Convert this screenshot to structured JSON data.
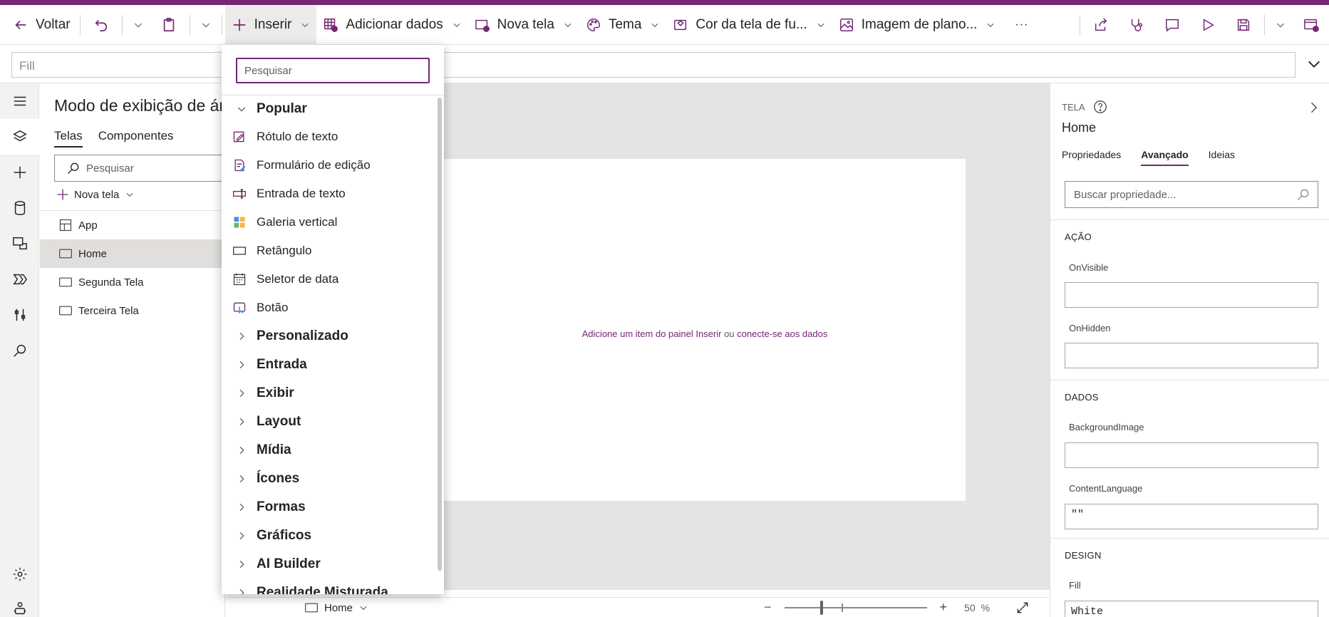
{
  "commandbar": {
    "back": "Voltar",
    "insert": "Inserir",
    "add_data": "Adicionar dados",
    "new_screen": "Nova tela",
    "theme": "Tema",
    "bg_color": "Cor da tela de fu...",
    "bg_image": "Imagem de plano...",
    "more": "···"
  },
  "formula": {
    "property": "Fill"
  },
  "tree": {
    "title": "Modo de exibição de árvore",
    "tabs": [
      "Telas",
      "Componentes"
    ],
    "search_placeholder": "Pesquisar",
    "new_screen": "Nova tela",
    "items": [
      {
        "label": "App",
        "icon": "app-icon"
      },
      {
        "label": "Home",
        "icon": "screen-icon",
        "selected": true
      },
      {
        "label": "Segunda Tela",
        "icon": "screen-icon"
      },
      {
        "label": "Terceira Tela",
        "icon": "screen-icon"
      }
    ]
  },
  "insert_panel": {
    "search_placeholder": "Pesquisar",
    "popular_label": "Popular",
    "popular_items": [
      {
        "label": "Rótulo de texto",
        "icon": "text-label-icon"
      },
      {
        "label": "Formulário de edição",
        "icon": "edit-form-icon"
      },
      {
        "label": "Entrada de texto",
        "icon": "text-input-icon"
      },
      {
        "label": "Galeria vertical",
        "icon": "gallery-icon"
      },
      {
        "label": "Retângulo",
        "icon": "rectangle-icon"
      },
      {
        "label": "Seletor de data",
        "icon": "date-picker-icon"
      },
      {
        "label": "Botão",
        "icon": "button-icon"
      }
    ],
    "categories": [
      "Personalizado",
      "Entrada",
      "Exibir",
      "Layout",
      "Mídia",
      "Ícones",
      "Formas",
      "Gráficos",
      "AI Builder",
      "Realidade Misturada"
    ]
  },
  "canvas": {
    "hint_link1": "Adicione um item do painel Inserir",
    "hint_or": " ou ",
    "hint_link2": "conecte-se aos dados"
  },
  "statusbar": {
    "screen": "Home",
    "zoom_value": "50",
    "zoom_unit": "%",
    "zoom_minus": "−",
    "zoom_plus": "+"
  },
  "props": {
    "kind": "TELA",
    "name": "Home",
    "tabs": [
      "Propriedades",
      "Avançado",
      "Ideias"
    ],
    "selected_tab": "Avançado",
    "search_placeholder": "Buscar propriedade...",
    "sections": {
      "action": "AÇÃO",
      "data": "DADOS",
      "design": "DESIGN"
    },
    "fields": {
      "onvisible_label": "OnVisible",
      "onvisible_value": "",
      "onhidden_label": "OnHidden",
      "onhidden_value": "",
      "bgimage_label": "BackgroundImage",
      "bgimage_value": "",
      "contentlang_label": "ContentLanguage",
      "contentlang_value": "\"\"",
      "fill_label": "Fill",
      "fill_value": "White"
    }
  },
  "colors": {
    "accent": "#742774",
    "link": "#742774"
  }
}
